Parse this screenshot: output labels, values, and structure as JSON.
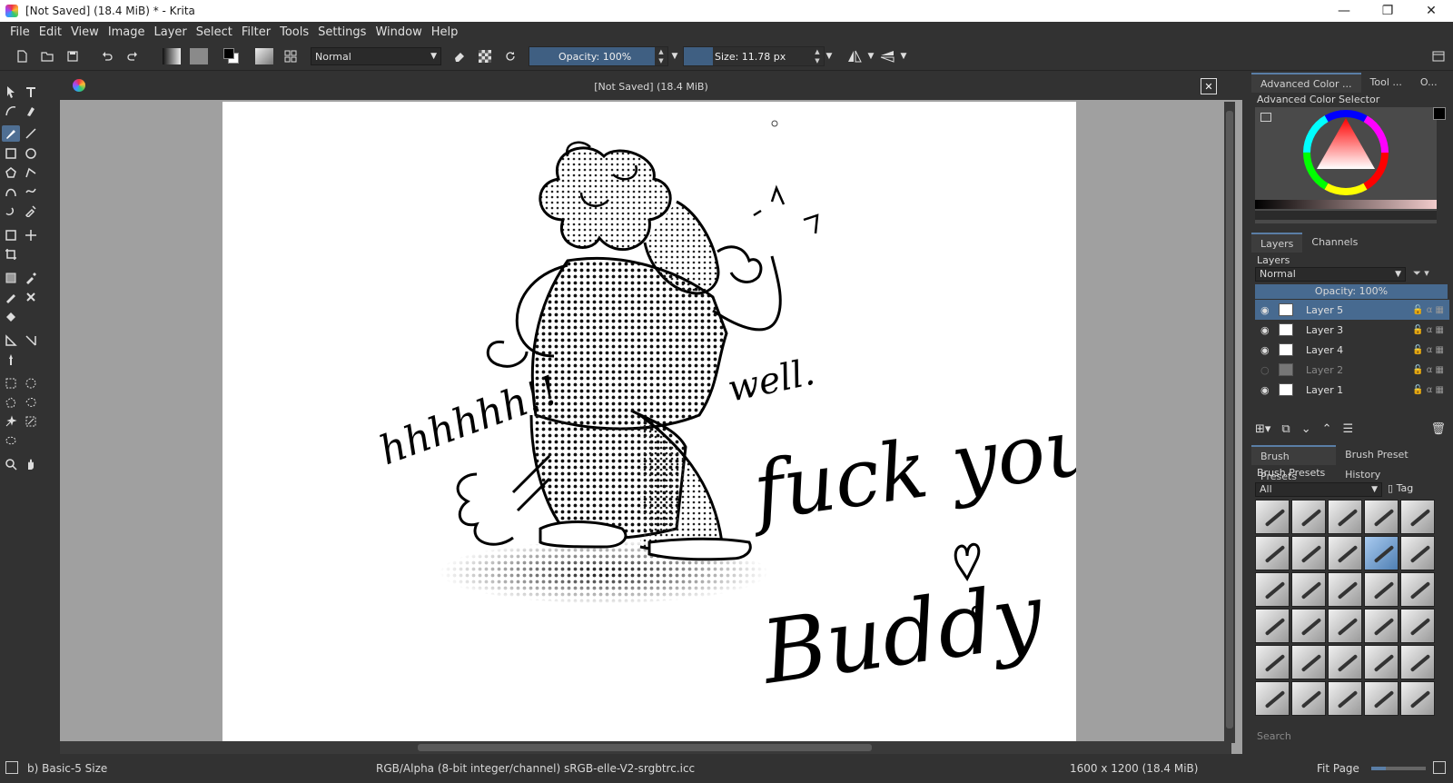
{
  "window": {
    "title": "[Not Saved]  (18.4 MiB) * - Krita",
    "minimize": "—",
    "restore": "❐",
    "close": "✕"
  },
  "menu": [
    "File",
    "Edit",
    "View",
    "Image",
    "Layer",
    "Select",
    "Filter",
    "Tools",
    "Settings",
    "Window",
    "Help"
  ],
  "toolbar": {
    "blend_mode": "Normal",
    "opacity_label": "Opacity:  100%",
    "size_label": "Size:  11.78 px"
  },
  "document": {
    "tab_title": "[Not Saved]  (18.4 MiB)",
    "close": "✕"
  },
  "docker": {
    "top_tabs": [
      "Advanced Color ...",
      "Tool ...",
      "O..."
    ],
    "color_selector_title": "Advanced Color Selector",
    "layer_tabs": [
      "Layers",
      "Channels"
    ],
    "layers_title": "Layers",
    "layer_blend": "Normal",
    "layer_opacity": "Opacity:  100%",
    "layers": [
      {
        "name": "Layer 5",
        "visible": true,
        "selected": true
      },
      {
        "name": "Layer 3",
        "visible": true,
        "selected": false
      },
      {
        "name": "Layer 4",
        "visible": true,
        "selected": false
      },
      {
        "name": "Layer 2",
        "visible": false,
        "selected": false
      },
      {
        "name": "Layer 1",
        "visible": true,
        "selected": false
      }
    ],
    "brush_tabs": [
      "Brush Presets",
      "Brush Preset History"
    ],
    "brush_title": "Brush Presets",
    "brush_filter": "All",
    "brush_tag": "Tag",
    "search_placeholder": "Search"
  },
  "canvas": {
    "text_left": "hhhhhh!!",
    "text_well": "well.",
    "text_main": "fuck you,",
    "text_buddy": "Buddy"
  },
  "status": {
    "brush": "b) Basic-5 Size",
    "color_space": "RGB/Alpha (8-bit integer/channel)  sRGB-elle-V2-srgbtrc.icc",
    "dimensions": "1600 x 1200 (18.4 MiB)",
    "zoom": "Fit Page"
  }
}
